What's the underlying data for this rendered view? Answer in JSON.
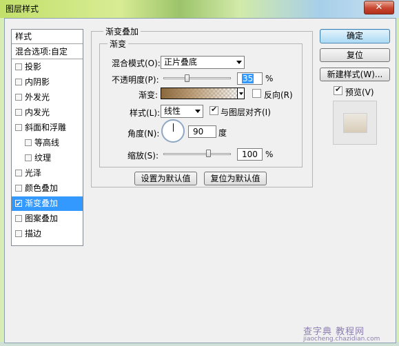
{
  "window": {
    "title": "图层样式",
    "close_symbol": "✕"
  },
  "sidebar": {
    "header": "样式",
    "blend_options": "混合选项:自定",
    "items": [
      {
        "label": "投影",
        "checked": false
      },
      {
        "label": "内阴影",
        "checked": false
      },
      {
        "label": "外发光",
        "checked": false
      },
      {
        "label": "内发光",
        "checked": false
      },
      {
        "label": "斜面和浮雕",
        "checked": false
      },
      {
        "label": "等高线",
        "checked": false
      },
      {
        "label": "纹理",
        "checked": false
      },
      {
        "label": "光泽",
        "checked": false
      },
      {
        "label": "颜色叠加",
        "checked": false
      },
      {
        "label": "渐变叠加",
        "checked": true,
        "selected": true
      },
      {
        "label": "图案叠加",
        "checked": false
      },
      {
        "label": "描边",
        "checked": false
      }
    ]
  },
  "panel": {
    "outer_title": "渐变叠加",
    "inner_title": "渐变",
    "blend_mode_label": "混合模式(O):",
    "blend_mode_value": "正片叠底",
    "opacity_label": "不透明度(P):",
    "opacity_value": "35",
    "opacity_unit": "%",
    "opacity_level": 0.35,
    "gradient_label": "渐变:",
    "reverse_label": "反向(R)",
    "reverse_checked": false,
    "style_label": "样式(L):",
    "style_value": "线性",
    "align_label": "与图层对齐(I)",
    "align_checked": true,
    "angle_label": "角度(N):",
    "angle_value": "90",
    "angle_unit": "度",
    "scale_label": "缩放(S):",
    "scale_value": "100",
    "scale_unit": "%",
    "scale_level": 0.67,
    "set_default_button": "设置为默认值",
    "reset_default_button": "复位为默认值"
  },
  "actions": {
    "ok": "确定",
    "reset": "复位",
    "new_style": "新建样式(W)...",
    "preview_label": "预览(V)",
    "preview_checked": true
  },
  "watermark": {
    "line1": "查字典 教程网",
    "line2": "jiaocheng.chazidian.com"
  },
  "colors": {
    "selection": "#3399ff",
    "gradient_start": "#8a683c",
    "gradient_end": "#d7c8b4"
  }
}
